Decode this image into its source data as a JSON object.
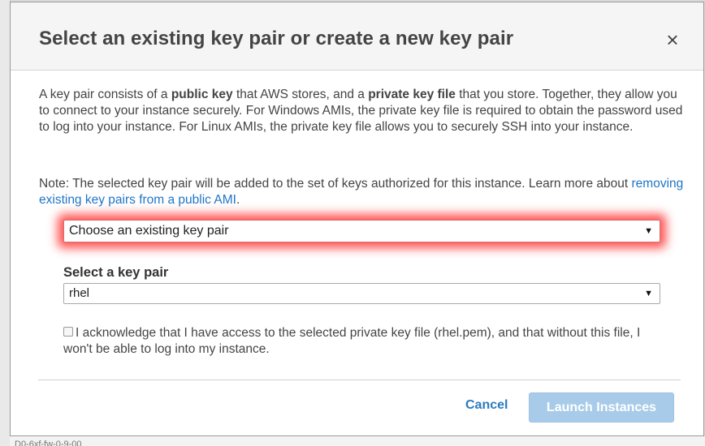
{
  "background": {
    "bottom_text": "D0-6xf-fw-0-9-00"
  },
  "dialog": {
    "title": "Select an existing key pair or create a new key pair",
    "close_glyph": "×",
    "intro": {
      "t1": "A key pair consists of a ",
      "b1": "public key",
      "t2": " that AWS stores, and a ",
      "b2": "private key file",
      "t3": " that you store. Together, they allow you to connect to your instance securely. For Windows AMIs, the private key file is required to obtain the password used to log into your instance. For Linux AMIs, the private key file allows you to securely SSH into your instance."
    },
    "note": {
      "text": "Note: The selected key pair will be added to the set of keys authorized for this instance. Learn more about ",
      "link": "removing existing key pairs from a public AMI",
      "end": "."
    },
    "key_source_select": {
      "value": "Choose an existing key pair",
      "highlight_color": "#ff2323"
    },
    "key_pair_label": "Select a key pair",
    "key_pair_select": {
      "value": "rhel"
    },
    "acknowledge": {
      "checked": false,
      "text": "I acknowledge that I have access to the selected private key file (rhel.pem), and that without this file, I won't be able to log into my instance."
    },
    "buttons": {
      "cancel": "Cancel",
      "launch": "Launch Instances"
    },
    "colors": {
      "link": "#1f75c8",
      "launch_button_disabled": "#a8cbe9"
    }
  }
}
